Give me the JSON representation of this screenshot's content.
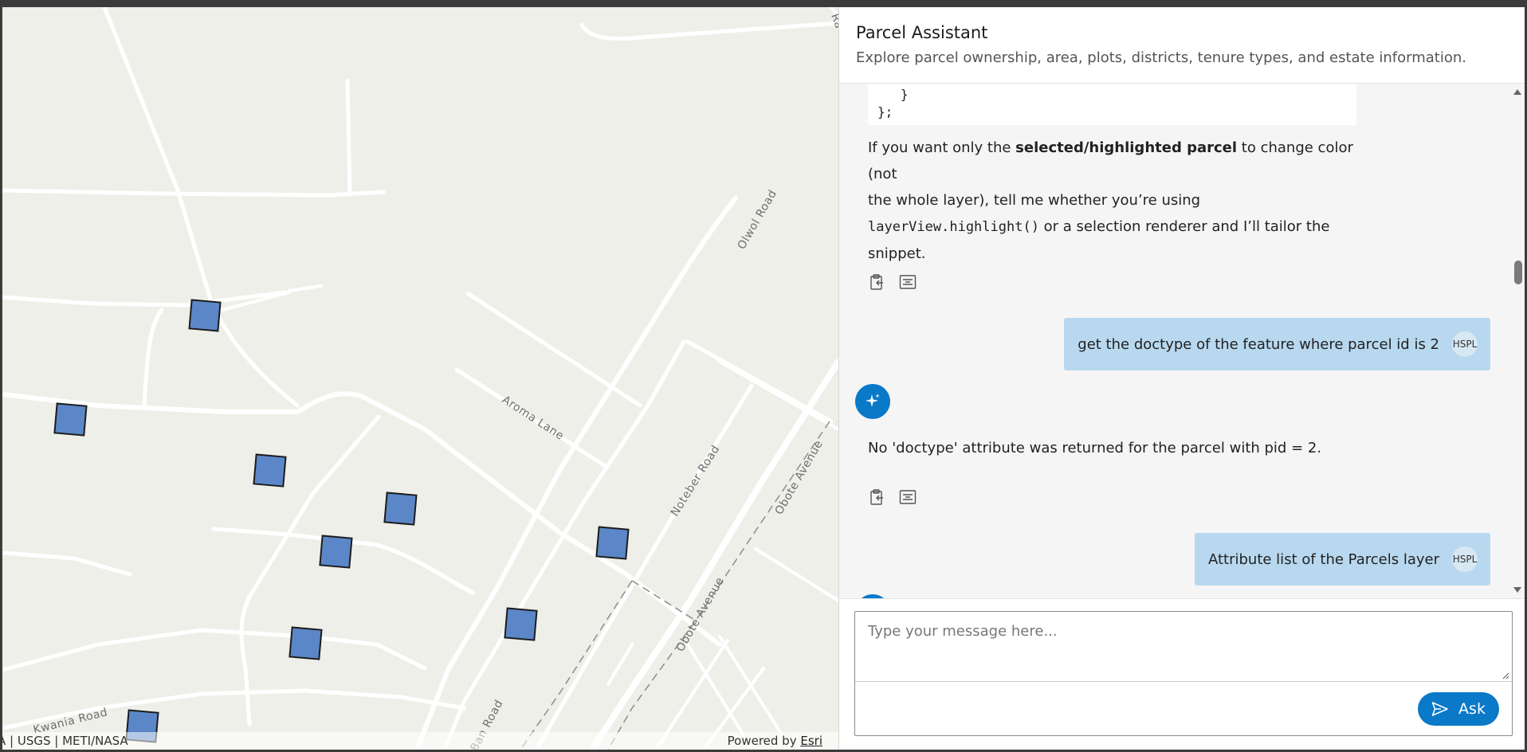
{
  "map": {
    "road_labels": [
      {
        "id": "olwol",
        "text": "Olwol Road"
      },
      {
        "id": "aroma",
        "text": "Aroma Lane"
      },
      {
        "id": "noteber",
        "text": "Noteber Road"
      },
      {
        "id": "obote1",
        "text": "Obote Avenue"
      },
      {
        "id": "obote2",
        "text": "Obote Avenue"
      },
      {
        "id": "kwania",
        "text": "Kwania Road"
      },
      {
        "id": "ban",
        "text": "Ban Road"
      },
      {
        "id": "topcut",
        "text": "Ra"
      }
    ],
    "attribution_left": "A | USGS | METI/NASA",
    "attribution_powered": "Powered by ",
    "attribution_link": "Esri",
    "parcel_marker_color": "#5b87c8"
  },
  "panel": {
    "title": "Parcel Assistant",
    "subtitle": "Explore parcel ownership, area, plots, districts, tenure types, and estate information."
  },
  "chat": {
    "code_tail": "   }\n};",
    "bot1_pre": "If you want only the ",
    "bot1_bold": "selected/highlighted parcel",
    "bot1_mid": " to change color (not",
    "bot1_line2": "the whole layer), tell me whether you’re using",
    "bot1_code": "layerView.highlight()",
    "bot1_post": " or a selection renderer and I’ll tailor the",
    "bot1_line4": "snippet.",
    "user1": "get the doctype of the feature where parcel id is 2",
    "user_initials": "HSPL",
    "bot2": "No 'doctype' attribute was returned for the parcel with pid = 2.",
    "user2": "Attribute list of the Parcels layer"
  },
  "composer": {
    "placeholder": "Type your message here...",
    "ask_label": "Ask"
  },
  "colors": {
    "accent": "#0a79c8",
    "user_bubble": "#b8d8ef"
  }
}
